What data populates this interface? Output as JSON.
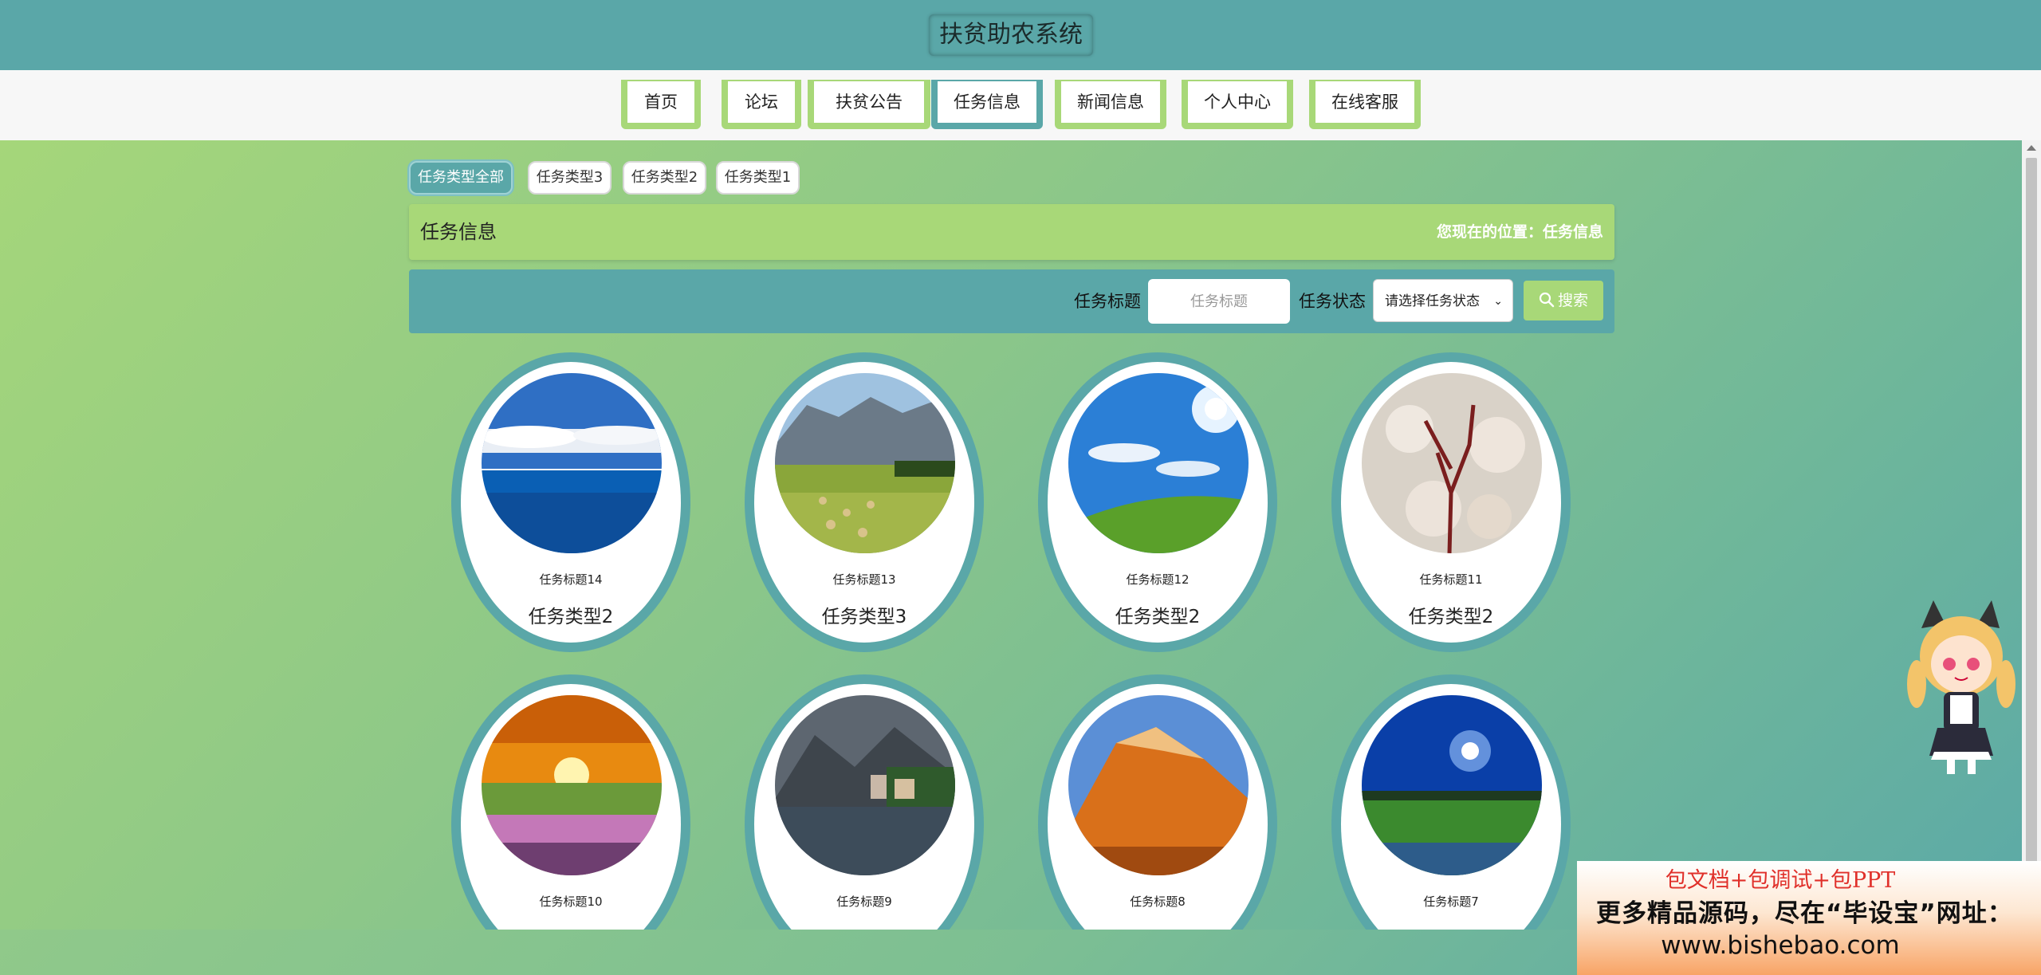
{
  "site": {
    "title": "扶贫助农系统"
  },
  "nav": {
    "items": [
      {
        "label": "首页"
      },
      {
        "label": "论坛"
      },
      {
        "label": "扶贫公告"
      },
      {
        "label": "任务信息"
      },
      {
        "label": "新闻信息"
      },
      {
        "label": "个人中心"
      },
      {
        "label": "在线客服"
      }
    ],
    "active": "任务信息"
  },
  "category_tabs": [
    {
      "label": "任务类型全部"
    },
    {
      "label": "任务类型3"
    },
    {
      "label": "任务类型2"
    },
    {
      "label": "任务类型1"
    }
  ],
  "location": {
    "title": "任务信息",
    "path": "您现在的位置：任务信息"
  },
  "search": {
    "title_label": "任务标题",
    "title_placeholder": "任务标题",
    "status_label": "任务状态",
    "status_selected": "请选择任务状态",
    "button_label": "搜索"
  },
  "cards": [
    {
      "title": "任务标题14",
      "type": "任务类型2",
      "image": "ocean-sky"
    },
    {
      "title": "任务标题13",
      "type": "任务类型3",
      "image": "mountain-meadow"
    },
    {
      "title": "任务标题12",
      "type": "任务类型2",
      "image": "sunny-hill"
    },
    {
      "title": "任务标题11",
      "type": "任务类型2",
      "image": "blossom-tree"
    },
    {
      "title": "任务标题10",
      "type": "",
      "image": "sunset-flowers"
    },
    {
      "title": "任务标题9",
      "type": "",
      "image": "lake-village"
    },
    {
      "title": "任务标题8",
      "type": "",
      "image": "red-mountain"
    },
    {
      "title": "任务标题7",
      "type": "",
      "image": "night-field"
    }
  ],
  "ad": {
    "line1": "包文档+包调试+包PPT",
    "line2": "更多精品源码，尽在“毕设宝”网址：",
    "line3": "www.bishebao.com"
  },
  "colors": {
    "primary": "#5aa7a8",
    "accent": "#a8d878"
  }
}
